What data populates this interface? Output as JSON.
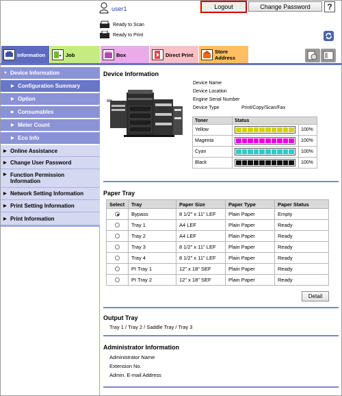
{
  "header": {
    "user_name": "user1",
    "logout_label": "Logout",
    "change_password_label": "Change Password",
    "help_label": "?",
    "status_scan": "Ready to Scan",
    "status_print": "Ready to Print"
  },
  "tabs": {
    "information": "Information",
    "job": "Job",
    "box": "Box",
    "direct_print": "Direct Print",
    "store_address": "Store Address"
  },
  "sidebar": {
    "device_information": "Device Information",
    "configuration_summary": "Configuration Summary",
    "option": "Option",
    "consumables": "Consumables",
    "meter_count": "Meter Count",
    "eco_info": "Eco Info",
    "online_assistance": "Online Assistance",
    "change_user_password": "Change User Password",
    "function_permission": "Function Permission Information",
    "network_setting": "Network Setting Information",
    "print_setting": "Print Setting Information",
    "print_information": "Print Information"
  },
  "device": {
    "title": "Device Information",
    "name_label": "Device Name",
    "location_label": "Device Location",
    "serial_label": "Engine Serial Number",
    "type_label": "Device Type",
    "type_value": "Print/Copy/Scan/Fax",
    "toner_header": "Toner",
    "status_header": "Status",
    "toners": [
      {
        "name": "Yellow",
        "color": "#d4d400",
        "level_percent": 100,
        "label": "100%"
      },
      {
        "name": "Magenta",
        "color": "#e600e6",
        "level_percent": 100,
        "label": "100%"
      },
      {
        "name": "Cyan",
        "color": "#33c9c9",
        "level_percent": 100,
        "label": "100%"
      },
      {
        "name": "Black",
        "color": "#111111",
        "level_percent": 100,
        "label": "100%"
      }
    ]
  },
  "paper_tray": {
    "title": "Paper Tray",
    "headers": [
      "Select",
      "Tray",
      "Paper Size",
      "Paper Type",
      "Paper Status"
    ],
    "rows": [
      {
        "selected": true,
        "tray": "Bypass",
        "size": "8 1/2\" x 11\" LEF",
        "type": "Plain Paper",
        "status": "Empty"
      },
      {
        "selected": false,
        "tray": "Tray 1",
        "size": "A4 LEF",
        "type": "Plain Paper",
        "status": "Ready"
      },
      {
        "selected": false,
        "tray": "Tray 2",
        "size": "A4 LEF",
        "type": "Plain Paper",
        "status": "Ready"
      },
      {
        "selected": false,
        "tray": "Tray 3",
        "size": "8 1/2\" x 11\" LEF",
        "type": "Plain Paper",
        "status": "Ready"
      },
      {
        "selected": false,
        "tray": "Tray 4",
        "size": "8 1/2\" x 11\" LEF",
        "type": "Plain Paper",
        "status": "Ready"
      },
      {
        "selected": false,
        "tray": "PI Tray 1",
        "size": "12\" x 18\" SEF",
        "type": "Plain Paper",
        "status": "Ready"
      },
      {
        "selected": false,
        "tray": "PI Tray 2",
        "size": "12\" x 18\" SEF",
        "type": "Plain Paper",
        "status": "Ready"
      }
    ],
    "detail_label": "Detail"
  },
  "output_tray": {
    "title": "Output Tray",
    "value": "Tray 1 / Tray 2 / Saddle Tray / Tray 3"
  },
  "admin": {
    "title": "Administrator Information",
    "name_label": "Administrator Name",
    "extension_label": "Extension No.",
    "email_label": "Admin. E-mail Address"
  },
  "colors": {
    "accent": "#6573c6",
    "logout_highlight": "#d40000"
  }
}
